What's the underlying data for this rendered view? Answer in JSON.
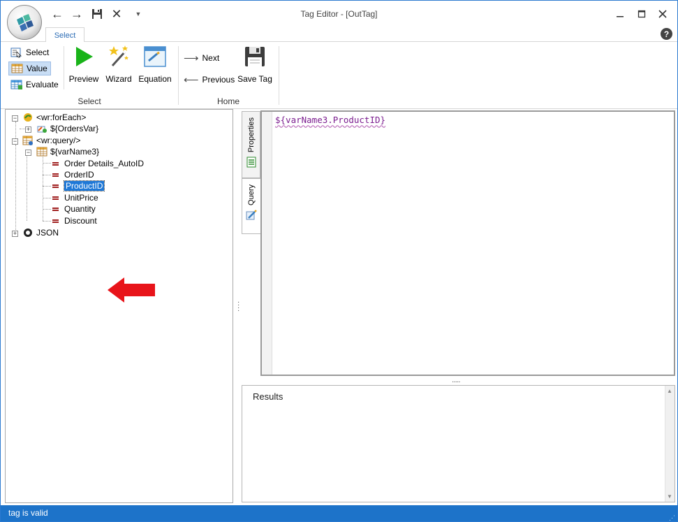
{
  "window": {
    "title": "Tag Editor - [OutTag]",
    "minimize_icon": "minimize-icon",
    "maximize_icon": "maximize-icon",
    "close_icon": "close-icon",
    "help_icon": "help-icon"
  },
  "quick_access": {
    "undo": "←",
    "redo": "→",
    "save": "💾",
    "cancel": "✕",
    "more": "▼"
  },
  "ribbon": {
    "active_tab": "Select",
    "select_group": {
      "label": "Select",
      "select": "Select",
      "value": "Value",
      "evaluate": "Evaluate",
      "preview": "Preview",
      "wizard": "Wizard",
      "equation": "Equation",
      "selected_mode": "Value"
    },
    "home_group": {
      "label": "Home",
      "next": "Next",
      "previous": "Previous",
      "save_tag": "Save Tag"
    }
  },
  "tree": {
    "nodes": [
      {
        "label": "<wr:forEach>",
        "expanded": true
      },
      {
        "label": "${OrdersVar}",
        "expanded": false
      },
      {
        "label": "<wr:query/>",
        "expanded": true
      },
      {
        "label": "${varName3}",
        "expanded": true
      },
      {
        "label": "Order Details_AutoID"
      },
      {
        "label": "OrderID"
      },
      {
        "label": "ProductID",
        "selected": true
      },
      {
        "label": "UnitPrice"
      },
      {
        "label": "Quantity"
      },
      {
        "label": "Discount"
      },
      {
        "label": "JSON",
        "expanded": false
      }
    ]
  },
  "side_tabs": {
    "properties": "Properties",
    "query": "Query",
    "active": "Query"
  },
  "editor": {
    "content": "${varName3.ProductID}"
  },
  "results": {
    "label": "Results"
  },
  "status": {
    "text": "tag is valid"
  },
  "colors": {
    "accent": "#1d73c9",
    "selection": "#1e78d7",
    "arrow": "#e8141a",
    "editor_text": "#7b1d8f"
  }
}
